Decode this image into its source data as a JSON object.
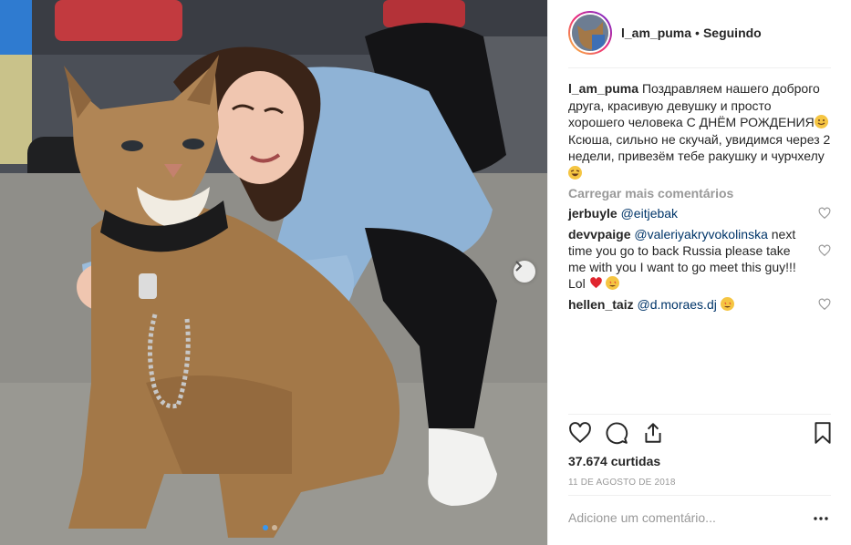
{
  "post": {
    "username": "l_am_puma",
    "separator": "•",
    "follow_status": "Seguindo"
  },
  "caption": {
    "username": "l_am_puma",
    "text_part1": "Поздравляем нашего доброго друга, красивую девушку и просто хорошего человека С ДНЁМ РОЖДЕНИЯ",
    "text_part2": " Ксюша, сильно не скучай, увидимся через 2 недели, привезём тебе ракушку и чурчхелу "
  },
  "load_more": "Carregar mais comentários",
  "comments": [
    {
      "username": "jerbuyle",
      "mention": "@eitjebak",
      "text": ""
    },
    {
      "username": "devvpaige",
      "mention": "@valeriyakryvokolinska",
      "text": " next time you go to back Russia please take me with you I want to go meet this guy!!! Lol "
    },
    {
      "username": "hellen_taiz",
      "mention": "@d.moraes.dj",
      "text": " "
    }
  ],
  "icons": {
    "like": "heart-outline-icon",
    "comment": "speech-bubble-icon",
    "share": "share-upload-icon",
    "save": "bookmark-icon",
    "more": "ellipsis-icon",
    "next": "chevron-right-icon"
  },
  "likes": "37.674 curtidas",
  "date": "11 DE AGOSTO DE 2018",
  "add_comment_placeholder": "Adicione um comentário...",
  "carousel": {
    "count": 2,
    "active_index": 0
  },
  "colors": {
    "text": "#262626",
    "muted": "#999999",
    "mention": "#003569",
    "carousel_active": "#3897f0",
    "heart_red": "#ed4956"
  }
}
